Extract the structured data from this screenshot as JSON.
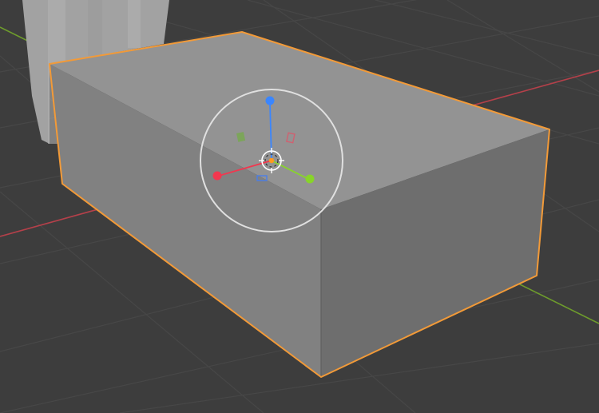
{
  "viewport": {
    "background_color": "#3d3d3d",
    "grid_color": "#474747",
    "x_axis_color": "#b5404a",
    "y_axis_color": "#6e9c2c"
  },
  "selected_object": {
    "name": "",
    "outline_color": "#f29a38",
    "face_colors": {
      "top": "#939393",
      "front": "#818181",
      "side": "#6e6e6e"
    }
  },
  "background_object": {
    "color": "#a9a9a9"
  },
  "gizmo": {
    "ring_color": "#e0e0e0",
    "x_handle_color": "#f2374f",
    "y_handle_color": "#88d42a",
    "z_handle_color": "#3a86ff",
    "origin_color": "#ff9a1f",
    "icons": [
      "move-gizmo-ring-icon",
      "x-axis-handle-icon",
      "y-axis-handle-icon",
      "z-axis-handle-icon",
      "plane-handle-icon",
      "origin-dot-icon"
    ]
  }
}
